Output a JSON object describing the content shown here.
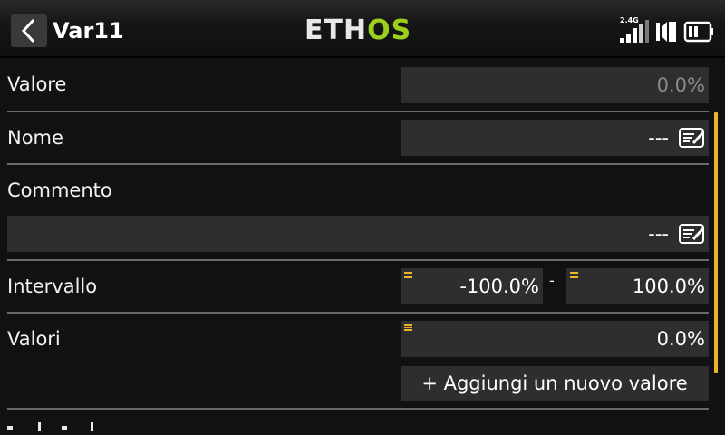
{
  "header": {
    "title": "Var11",
    "logo_eth": "ETH",
    "logo_os": "OS",
    "rf_band": "2.4G"
  },
  "rows": {
    "valore": {
      "label": "Valore",
      "value": "0.0%"
    },
    "nome": {
      "label": "Nome",
      "value": "---"
    },
    "commento": {
      "label": "Commento",
      "value": "---"
    },
    "intervallo": {
      "label": "Intervallo",
      "min": "-100.0%",
      "separator": "-",
      "max": "100.0%"
    },
    "valori": {
      "label": "Valori",
      "value": "0.0%",
      "add_button": "+ Aggiungi un nuovo valore"
    }
  },
  "colors": {
    "accent": "#f0b429",
    "logo_green": "#9ccf1e",
    "field_bg": "#2e2e2e",
    "background": "#111111"
  },
  "icons": [
    "back-icon",
    "signal-icon",
    "volume-icon",
    "battery-icon",
    "edit-icon"
  ]
}
